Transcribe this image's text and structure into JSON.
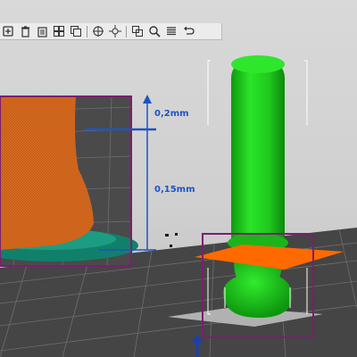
{
  "toolbar": {
    "buttons": [
      {
        "name": "add-icon"
      },
      {
        "name": "delete-icon"
      },
      {
        "name": "delete-all-icon"
      },
      {
        "name": "arrange-icon"
      },
      {
        "name": "copy-icon"
      },
      {
        "name": "separator"
      },
      {
        "name": "instances-icon"
      },
      {
        "name": "split-icon"
      },
      {
        "name": "separator"
      },
      {
        "name": "layers-editing-icon"
      },
      {
        "name": "search-icon"
      },
      {
        "name": "layers-icon"
      },
      {
        "name": "undo-icon"
      }
    ]
  },
  "annotation": {
    "layer_height_top": "0,2mm",
    "layer_height_bottom": "0,15mm"
  },
  "colors": {
    "accent_blue": "#1e53c6",
    "model_orange": "#d86a1c",
    "model_green": "#22d81f",
    "selection_purple": "#7a1f6e",
    "bed_grey": "#4a4a4a",
    "cut_plane": "#ff6a00"
  }
}
